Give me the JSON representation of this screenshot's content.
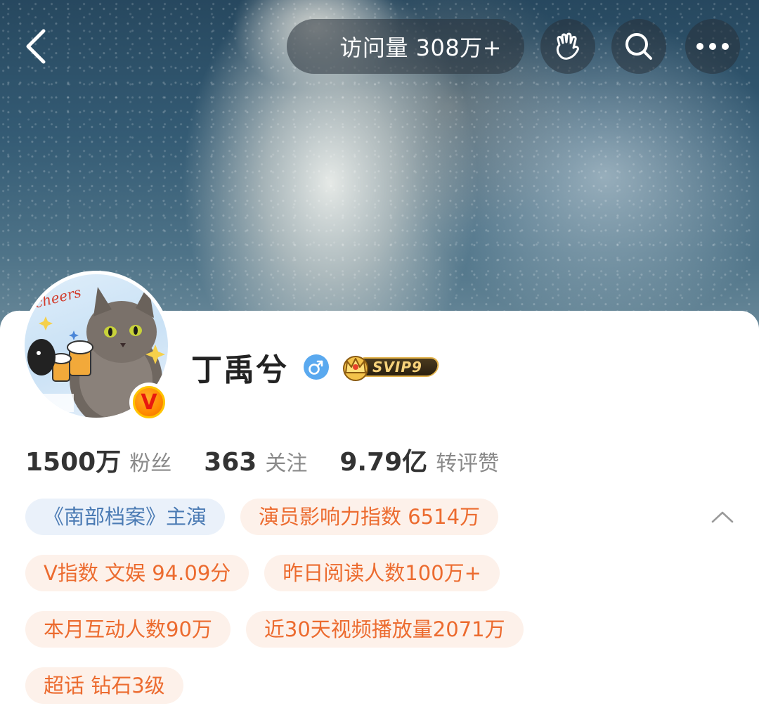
{
  "nav": {
    "visit_text": "访问量 308万+",
    "back_icon": "chevron-left-icon",
    "hand_icon": "waving-hand-icon",
    "search_icon": "search-icon",
    "more_icon": "more-dots-icon"
  },
  "profile": {
    "name": "丁禹兮",
    "gender_icon": "male-icon",
    "vip_badge": "SVIP9",
    "verified_badge": "V"
  },
  "stats": [
    {
      "value": "1500万",
      "label": "粉丝"
    },
    {
      "value": "363",
      "label": "关注"
    },
    {
      "value": "9.79亿",
      "label": "转评赞"
    }
  ],
  "tags": [
    {
      "text": "《南部档案》主演",
      "style": "blue"
    },
    {
      "text": "演员影响力指数 6514万",
      "style": "orange"
    },
    {
      "text": "V指数 文娱 94.09分",
      "style": "orange"
    },
    {
      "text": "昨日阅读人数100万+",
      "style": "orange"
    },
    {
      "text": "本月互动人数90万",
      "style": "orange"
    },
    {
      "text": "近30天视频播放量2071万",
      "style": "orange"
    },
    {
      "text": "超话 钻石3级",
      "style": "orange"
    }
  ],
  "colors": {
    "tag_blue_bg": "#eaf1fa",
    "tag_blue_text": "#4b7bb4",
    "tag_orange_bg": "#fdf1ea",
    "tag_orange_text": "#ec6b2f",
    "gender_blue": "#5aa9ef"
  }
}
